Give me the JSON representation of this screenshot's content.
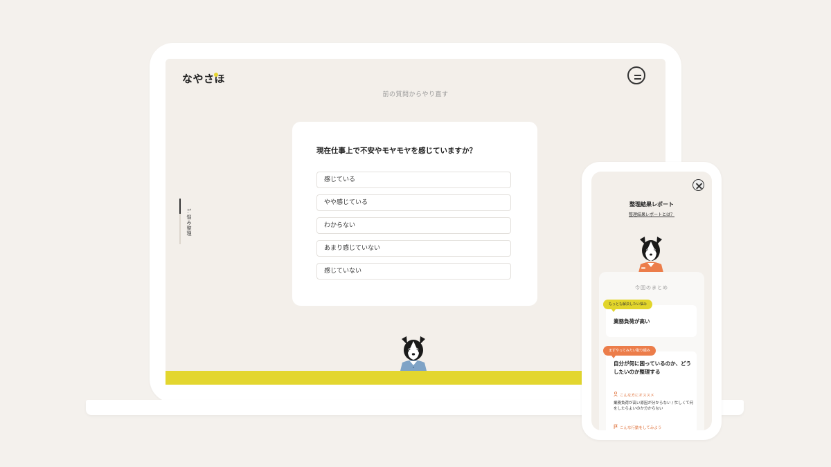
{
  "laptop": {
    "logo": "なやさほ",
    "redo_link": "前の質問からやり直す",
    "progress": {
      "label": "1.悩み整理",
      "fraction": 0.33
    },
    "question": {
      "title": "現在仕事上で不安やモヤモヤを感じていますか？",
      "options": [
        "感じている",
        "やや感じている",
        "わからない",
        "あまり感じていない",
        "感じていない"
      ]
    }
  },
  "phone": {
    "report_title": "整理結果レポート",
    "report_link": "整理結果レポートとは？",
    "summary_heading": "今回のまとめ",
    "worry": {
      "tag": "もっとも解決したい悩み",
      "title": "業務負荷が高い"
    },
    "action": {
      "tag": "まずやってみたい取り組み",
      "title": "自分が何に困っているのか、どうしたいのか整理する",
      "recommend_label": "こんな方にオススメ",
      "recommend_text": "業務負荷が高い原因が分からない / 忙しくて何をしたらよいのか分からない",
      "try_label": "こんな行動をしてみよう"
    }
  },
  "colors": {
    "accent_yellow": "#e3d62f",
    "accent_orange": "#ec7d4a",
    "background": "#f4f1ed",
    "screen_bg": "#f3efea"
  }
}
